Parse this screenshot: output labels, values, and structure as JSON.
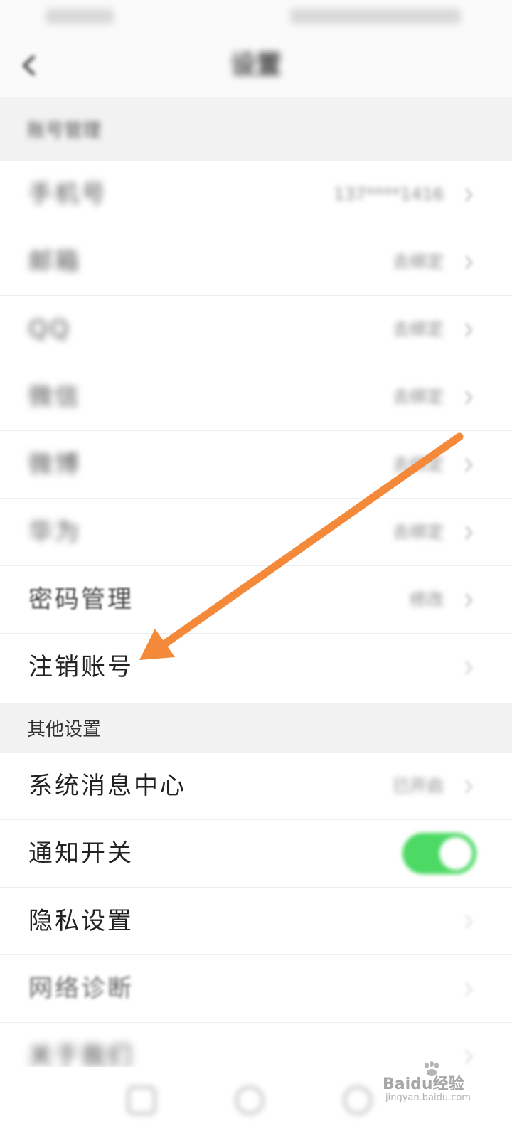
{
  "status_bar": {
    "time": "",
    "indicators": ""
  },
  "nav": {
    "back_icon": "chevron-left-icon",
    "title": "设置"
  },
  "sections": {
    "account": {
      "title": "账号管理"
    },
    "other": {
      "title": "其他设置"
    }
  },
  "account_rows": [
    {
      "label": "手机号",
      "value": "137****1416"
    },
    {
      "label": "邮箱",
      "value": "去绑定"
    },
    {
      "label": "QQ",
      "value": "去绑定"
    },
    {
      "label": "微信",
      "value": "去绑定"
    },
    {
      "label": "微博",
      "value": "去绑定"
    },
    {
      "label": "华为",
      "value": "去绑定"
    },
    {
      "label": "密码管理",
      "value": "修改"
    },
    {
      "label": "注销账号",
      "value": ""
    }
  ],
  "other_rows": [
    {
      "label": "系统消息中心",
      "value": "已开启"
    },
    {
      "label": "通知开关",
      "toggle_on": true
    },
    {
      "label": "隐私设置",
      "value": ""
    },
    {
      "label": "网络诊断",
      "value": ""
    },
    {
      "label": "关于我们",
      "value": ""
    }
  ],
  "tab_bar": {
    "icons": [
      "home-icon",
      "discover-icon",
      "profile-icon"
    ]
  },
  "watermark": {
    "brand": "Baidu经验",
    "url": "jingyan.baidu.com"
  },
  "colors": {
    "toggle_on": "#4cd964",
    "annotation_arrow": "#f5893a",
    "section_background": "#f2f2f2"
  }
}
